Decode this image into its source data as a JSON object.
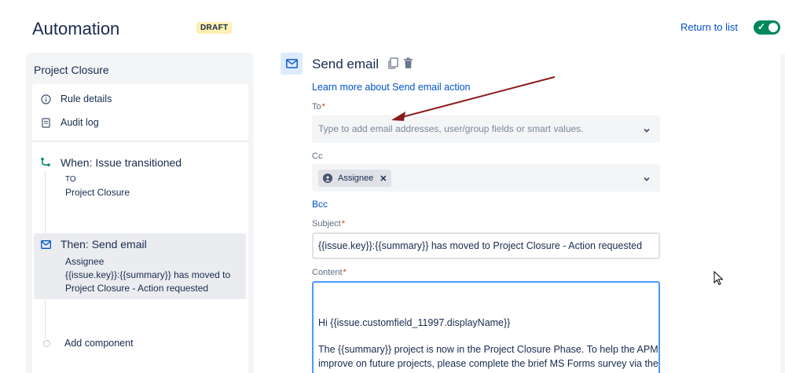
{
  "header": {
    "title": "Automation",
    "badge": "DRAFT",
    "return_link": "Return to list",
    "toggle_enabled": true,
    "toggle_color": "#00875a"
  },
  "sidebar": {
    "rule_name": "Project Closure",
    "items": [
      {
        "label": "Rule details",
        "icon": "info-icon"
      },
      {
        "label": "Audit log",
        "icon": "document-icon"
      }
    ],
    "trigger": {
      "title": "When: Issue transitioned",
      "to_label": "TO",
      "status": "Project Closure",
      "icon": "branch-icon"
    },
    "action": {
      "title": "Then: Send email",
      "recipient": "Assignee",
      "summary_line1": "{{issue.key}}:{{summary}} has moved to",
      "summary_line2": "Project Closure - Action requested",
      "icon": "mail-icon"
    },
    "add_component": "Add component"
  },
  "main": {
    "title": "Send email",
    "learn_more": "Learn more about Send email action",
    "to": {
      "label": "To",
      "required": "*",
      "placeholder": "Type to add email addresses, user/group fields or smart values."
    },
    "cc": {
      "label": "Cc",
      "tags": [
        "Assignee"
      ]
    },
    "bcc_link": "Bcc",
    "subject": {
      "label": "Subject",
      "required": "*",
      "value": "{{issue.key}}:{{summary}} has moved to Project Closure - Action requested"
    },
    "content": {
      "label": "Content",
      "required": "*",
      "lines": [
        "Hi {{issue.customfield_11997.displayName}}",
        "The {{summary}} project is now in the Project Closure Phase. To help the APM",
        "improve on future projects, please complete the brief MS Forms survey via the"
      ]
    }
  },
  "colors": {
    "link": "#0052cc",
    "badge_bg": "#fff0b3",
    "annotation_arrow": "#8b1a1a",
    "focus_border": "#4c9aff"
  }
}
